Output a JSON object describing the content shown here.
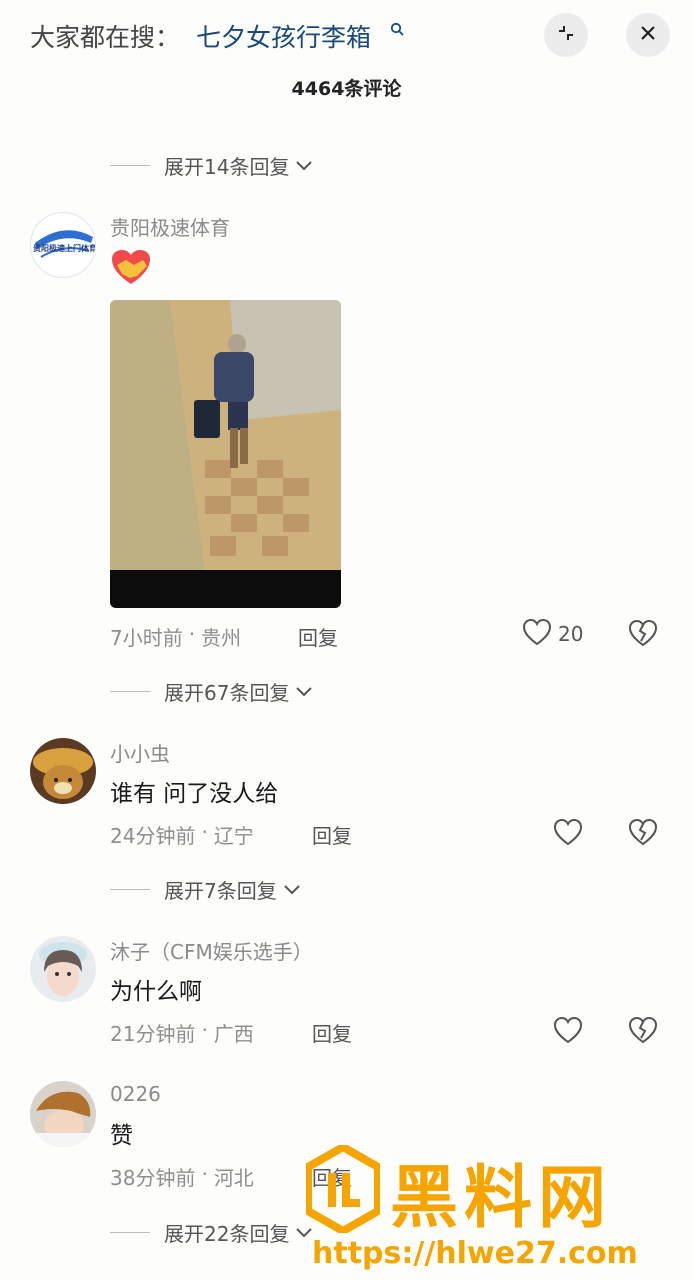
{
  "header": {
    "search_prefix": "大家都在搜：",
    "search_term": "七夕女孩行李箱",
    "comment_count": "4464条评论"
  },
  "expanders": {
    "e1": "展开14条回复",
    "e2": "展开67条回复",
    "e3": "展开7条回复",
    "e4": "展开22条回复"
  },
  "comments": [
    {
      "username": "贵阳极速体育",
      "text": "",
      "time": "7小时前",
      "location": "贵州",
      "reply": "回复",
      "likes": "20",
      "avatar_text": "贵阳极速上门体育"
    },
    {
      "username": "小小虫",
      "text": "谁有 问了没人给",
      "time": "24分钟前",
      "location": "辽宁",
      "reply": "回复"
    },
    {
      "username": "沐子（CFM娱乐选手）",
      "text": "为什么啊",
      "time": "21分钟前",
      "location": "广西",
      "reply": "回复"
    },
    {
      "username": "0226",
      "text": "赞",
      "time": "38分钟前",
      "location": "河北",
      "reply": "回复"
    }
  ],
  "watermark": {
    "text": "黑料网",
    "url": "https://hlwe27.com"
  },
  "colors": {
    "accent_link": "#17497a",
    "watermark": "#f5a400"
  }
}
